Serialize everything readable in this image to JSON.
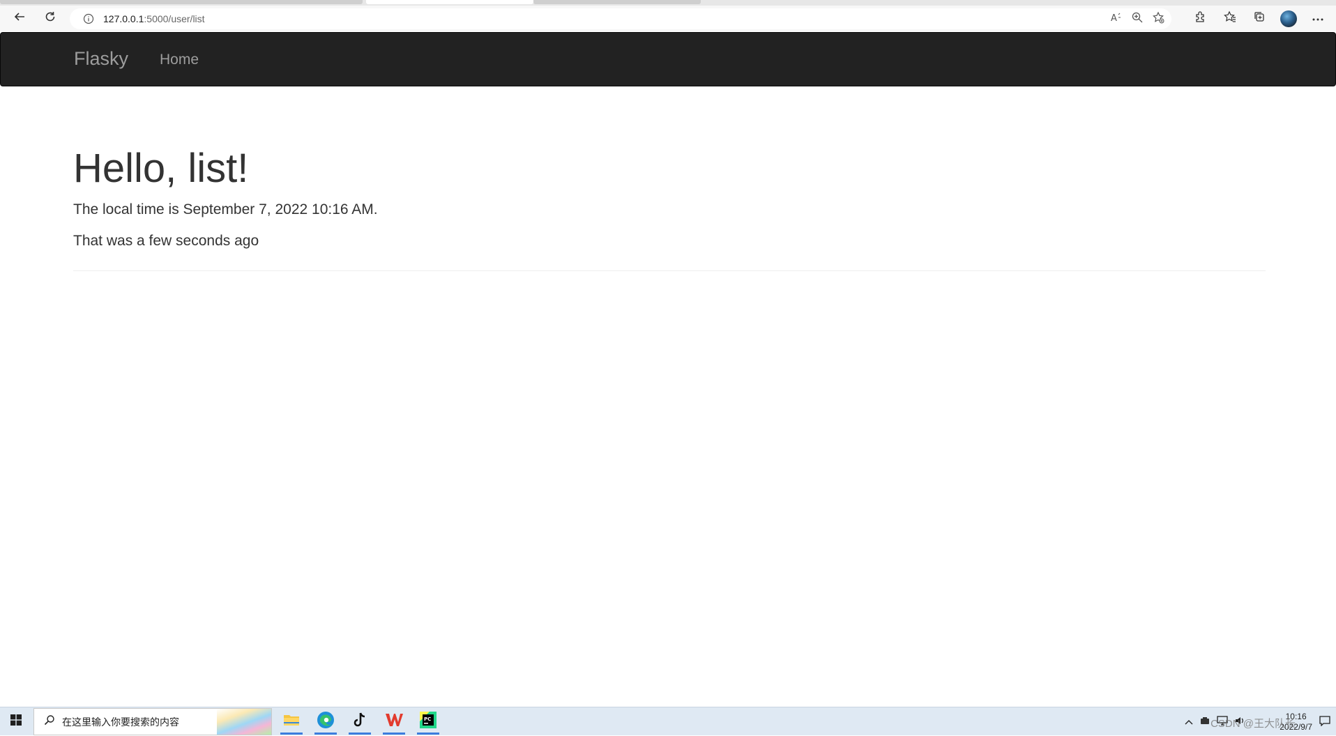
{
  "browser": {
    "url_host": "127.0.0.1",
    "url_path": ":5000/user/list"
  },
  "navbar": {
    "brand": "Flasky",
    "home": "Home"
  },
  "page": {
    "heading": "Hello, list!",
    "local_time_text": "The local time is September 7, 2022 10:16 AM.",
    "relative_time_text": "That was a few seconds ago"
  },
  "taskbar": {
    "search_placeholder": "在这里输入你要搜索的内容",
    "time": "10:16",
    "date": "2022/9/7",
    "watermark": "CSDN @王大队长"
  },
  "icons": [
    "back-icon",
    "refresh-icon",
    "info-icon",
    "read-aloud-icon",
    "zoom-icon",
    "add-favorite-icon",
    "extensions-icon",
    "favorites-icon",
    "collections-icon",
    "profile-avatar",
    "more-icon",
    "windows-start-icon",
    "search-icon",
    "file-explorer-icon",
    "edge-icon",
    "tiktok-icon",
    "wps-icon",
    "pycharm-icon"
  ],
  "colors": {
    "navbar_bg": "#222222",
    "navbar_text": "#9d9d9d",
    "body_text": "#333333"
  }
}
